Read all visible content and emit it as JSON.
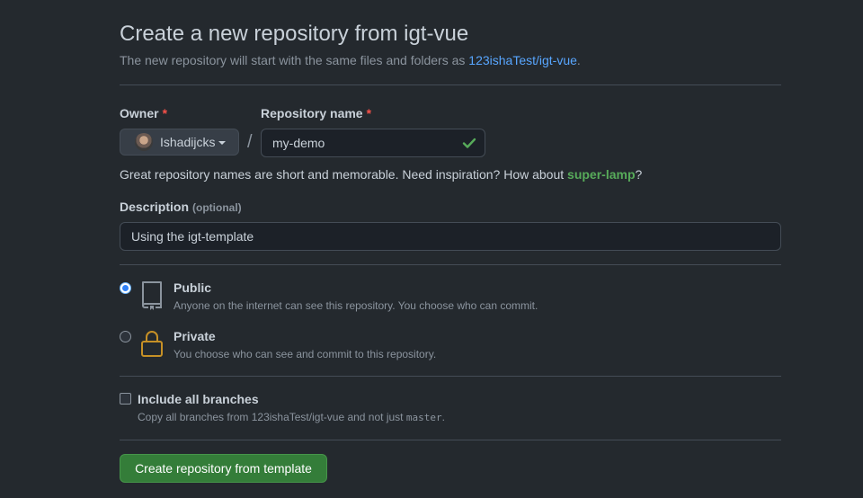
{
  "header": {
    "title": "Create a new repository from igt-vue",
    "subtitle_prefix": "The new repository will start with the same files and folders as ",
    "subtitle_link": "123ishaTest/igt-vue",
    "subtitle_suffix": "."
  },
  "owner": {
    "label": "Owner",
    "required_mark": "*",
    "value": "Ishadijcks"
  },
  "separator": "/",
  "repo_name": {
    "label": "Repository name",
    "required_mark": "*",
    "value": "my-demo"
  },
  "name_hint": {
    "prefix": "Great repository names are short and memorable. Need inspiration? How about ",
    "suggestion": "super-lamp",
    "suffix": "?"
  },
  "description": {
    "label": "Description",
    "optional": "(optional)",
    "value": "Using the igt-template"
  },
  "visibility": {
    "selected": "public",
    "options": [
      {
        "id": "public",
        "title": "Public",
        "desc": "Anyone on the internet can see this repository. You choose who can commit.",
        "icon": "repo-icon"
      },
      {
        "id": "private",
        "title": "Private",
        "desc": "You choose who can see and commit to this repository.",
        "icon": "lock-icon"
      }
    ]
  },
  "include_branches": {
    "title": "Include all branches",
    "desc_prefix": "Copy all branches from 123ishaTest/igt-vue and not just ",
    "desc_code": "master",
    "desc_suffix": ".",
    "checked": false
  },
  "submit": {
    "label": "Create repository from template"
  },
  "colors": {
    "background": "#24292e",
    "link": "#58a6ff",
    "success": "#57ab5a",
    "button": "#347d39",
    "required": "#f85149",
    "lock": "#c69026"
  }
}
